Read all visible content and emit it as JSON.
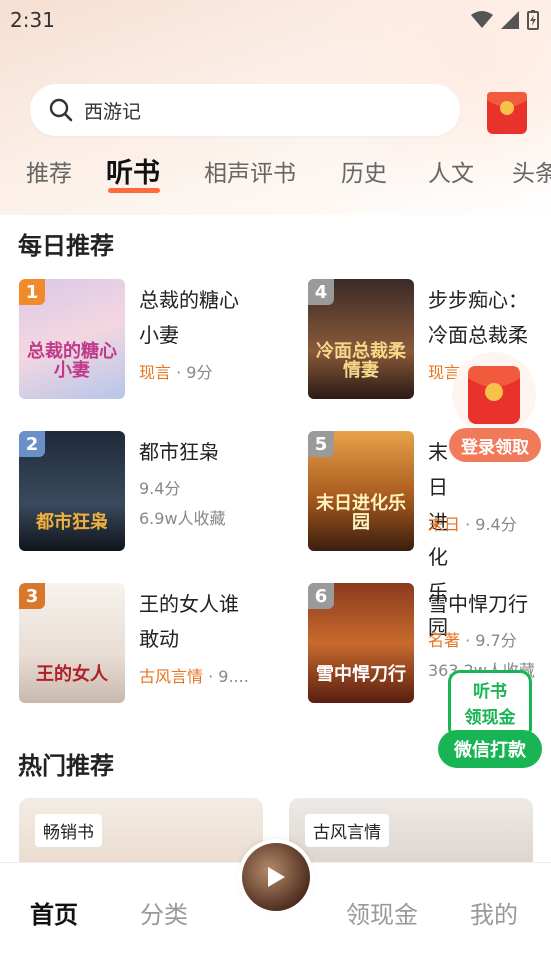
{
  "status_bar": {
    "time": "2:31"
  },
  "search": {
    "query": "西游记"
  },
  "tabs": [
    "推荐",
    "听书",
    "相声评书",
    "历史",
    "人文",
    "头条"
  ],
  "daily": {
    "title": "每日推荐",
    "books": [
      {
        "rank": "1",
        "title": "总裁的糖心小妻",
        "genre": "现言",
        "meta": " · 9分",
        "meta2": "",
        "cover_text": "总裁的糖心小妻",
        "rank_color": "#f08a2a"
      },
      {
        "rank": "4",
        "title": "步步痴心：冷面总裁柔",
        "genre": "现言",
        "meta": "",
        "meta2": "",
        "cover_text": "冷面总裁柔情妻",
        "rank_color": "#9a9a9a"
      },
      {
        "rank": "2",
        "title": "都市狂枭",
        "genre": "",
        "meta": "9.4分",
        "meta2": "6.9w人收藏",
        "cover_text": "都市狂枭",
        "rank_color": "#6b8fc7"
      },
      {
        "rank": "5",
        "title": "末日进化乐园",
        "genre": "末日",
        "meta": " · 9.4分",
        "meta2": "",
        "cover_text": "末日进化乐园",
        "rank_color": "#9a9a9a"
      },
      {
        "rank": "3",
        "title": "王的女人谁敢动",
        "genre": "古风言情",
        "meta": " · 9....",
        "meta2": "",
        "cover_text": "王的女人",
        "rank_color": "#d9772a"
      },
      {
        "rank": "6",
        "title": "雪中悍刀行",
        "genre": "名著",
        "meta": " · 9.7分",
        "meta2": "363.2w人收藏",
        "cover_text": "雪中悍刀行",
        "rank_color": "#9a9a9a"
      }
    ]
  },
  "float_reward": {
    "label": "登录领取"
  },
  "cash_float": {
    "line1": "听书",
    "line2": "领现金",
    "button": "微信打款"
  },
  "hot": {
    "title": "热门推荐",
    "cards": [
      {
        "tag": "畅销书"
      },
      {
        "tag": "古风言情"
      }
    ]
  },
  "nav": {
    "home": "首页",
    "category": "分类",
    "cash": "领现金",
    "mine": "我的"
  },
  "colors": {
    "accent": "#ff6a3c",
    "genre": "#e8731f",
    "wechat_green": "#19b453"
  }
}
